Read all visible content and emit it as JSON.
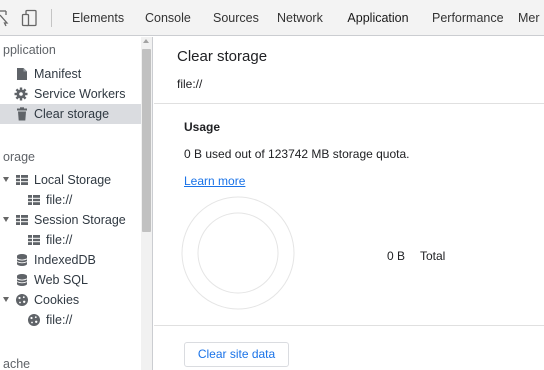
{
  "tabbar": {
    "tabs": [
      {
        "label": "Elements"
      },
      {
        "label": "Console"
      },
      {
        "label": "Sources"
      },
      {
        "label": "Network"
      },
      {
        "label": "Application",
        "active": true
      },
      {
        "label": "Performance"
      },
      {
        "label": "Mer"
      }
    ],
    "inspect_icon": "inspect-element-icon",
    "device_icon": "device-toolbar-icon",
    "accent_color": "#1a73e8"
  },
  "sidebar": {
    "sections": {
      "application": "pplication",
      "storage": "orage",
      "cache": "ache"
    },
    "items": {
      "manifest": "Manifest",
      "service_workers": "Service Workers",
      "clear_storage": "Clear storage",
      "local_storage": "Local Storage",
      "local_storage_file": "file://",
      "session_storage": "Session Storage",
      "session_storage_file": "file://",
      "indexeddb": "IndexedDB",
      "websql": "Web SQL",
      "cookies": "Cookies",
      "cookies_file": "file://"
    },
    "selected": "clear_storage"
  },
  "main": {
    "title": "Clear storage",
    "origin": "file://",
    "usage_heading": "Usage",
    "usage_text": "0 B used out of 123742 MB storage quota.",
    "learn_more": "Learn more",
    "total_value": "0 B",
    "total_label": "Total",
    "clear_button": "Clear site data"
  }
}
